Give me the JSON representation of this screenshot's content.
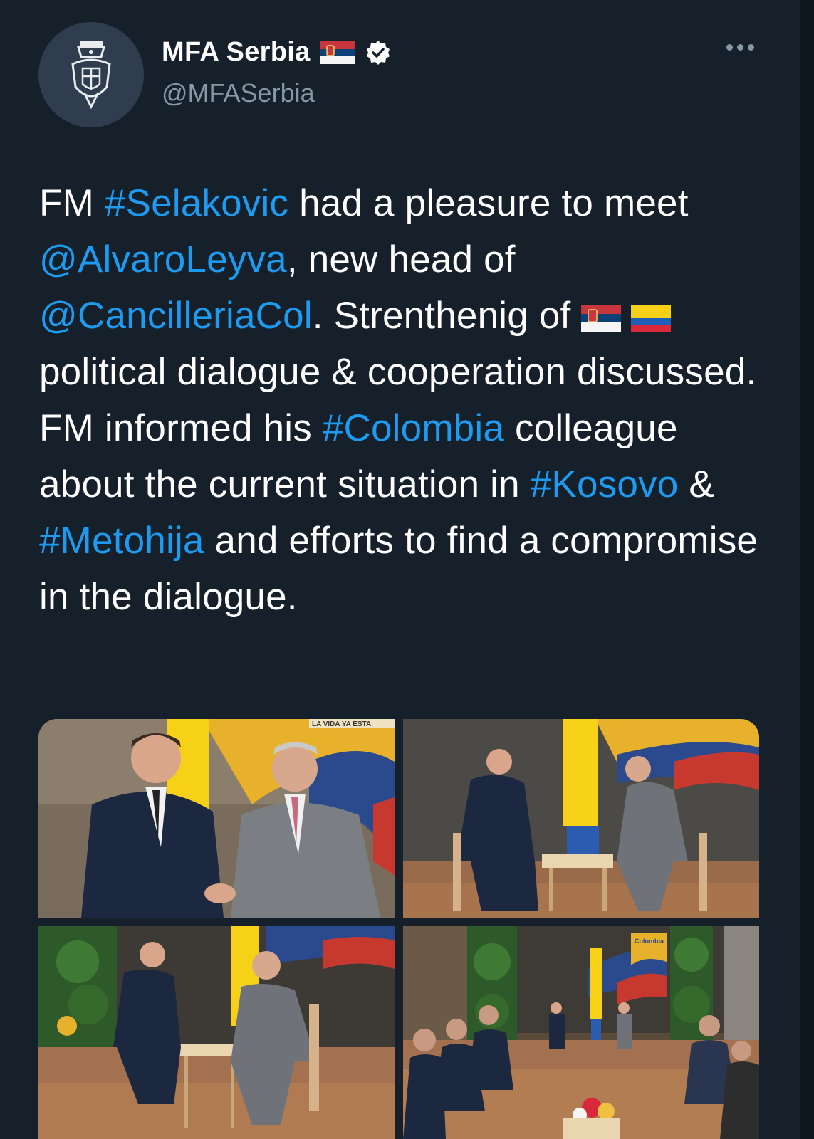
{
  "account": {
    "display_name": "MFA Serbia",
    "handle": "@MFASerbia",
    "verified": true,
    "flag_icon": "serbia-flag-icon",
    "avatar_icon": "serbian-coat-of-arms-icon"
  },
  "tweet": {
    "segments": [
      {
        "text": "FM ",
        "type": "text"
      },
      {
        "text": "#Selakovic",
        "type": "hashtag"
      },
      {
        "text": " had a pleasure to meet ",
        "type": "text"
      },
      {
        "text": "@AlvaroLeyva",
        "type": "mention"
      },
      {
        "text": ", new head of ",
        "type": "text"
      },
      {
        "text": "@CancilleriaCol",
        "type": "mention"
      },
      {
        "text": ". Strenthenig of ",
        "type": "text"
      },
      {
        "text": " political dialogue & cooperation discussed. FM informed his ",
        "type": "text"
      },
      {
        "text": "#Colombia",
        "type": "hashtag"
      },
      {
        "text": " colleague about the current situation in ",
        "type": "text"
      },
      {
        "text": "#Kosovo",
        "type": "hashtag"
      },
      {
        "text": " & ",
        "type": "text"
      },
      {
        "text": "#Metohija",
        "type": "hashtag"
      },
      {
        "text": " and efforts to find a compromise in the dialogue.",
        "type": "text"
      }
    ],
    "emoji": [
      "serbia-flag-icon",
      "colombia-flag-icon"
    ]
  },
  "media": {
    "photos": [
      {
        "name": "photo-handshake",
        "alt_icon": "photo-icon"
      },
      {
        "name": "photo-seated-meeting",
        "alt_icon": "photo-icon"
      },
      {
        "name": "photo-seated-meeting-wide",
        "alt_icon": "photo-icon"
      },
      {
        "name": "photo-delegations",
        "alt_icon": "photo-icon"
      }
    ],
    "banner_text": "LA VIDA YA ESTA",
    "banner_text_2": "Colombia"
  },
  "colors": {
    "background": "#15202b",
    "text": "#ffffff",
    "secondary_text": "#8899a6",
    "link": "#1d9bf0",
    "colombia_yellow": "#f7d117",
    "colombia_blue": "#1f5fb8",
    "colombia_red": "#d9283a"
  }
}
